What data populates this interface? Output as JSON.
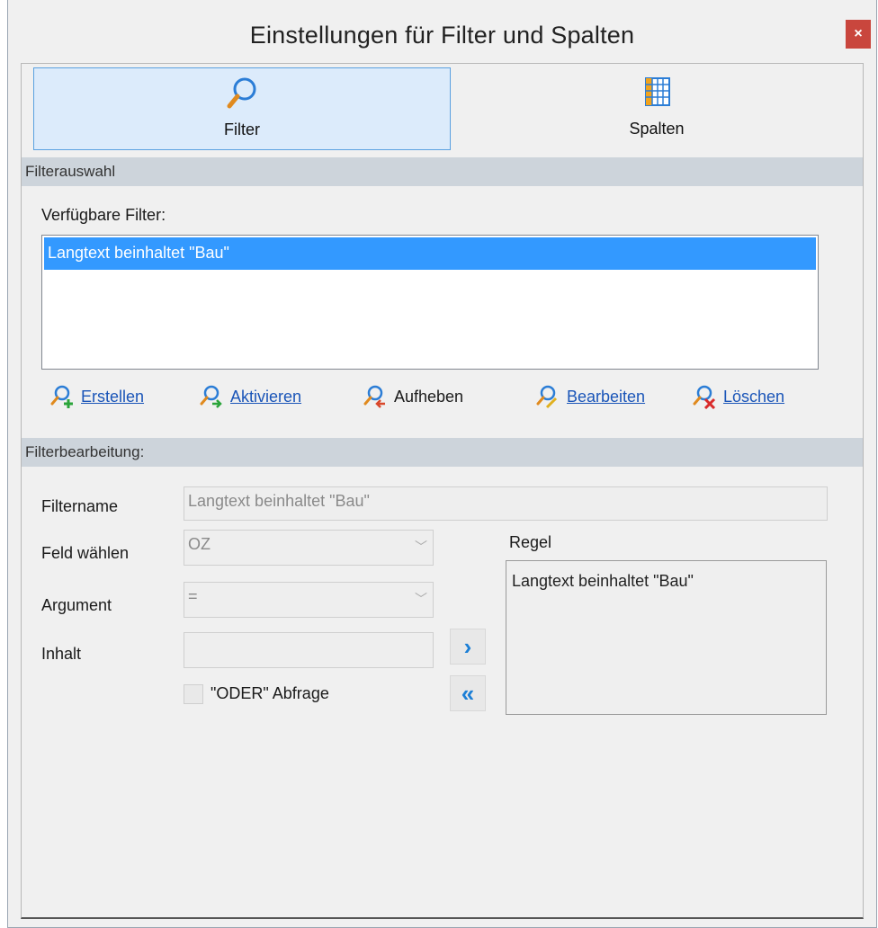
{
  "window": {
    "title": "Einstellungen für Filter und Spalten",
    "close_symbol": "×"
  },
  "toolbar": {
    "filter_label": "Filter",
    "spalten_label": "Spalten",
    "filter_icon": "magnifier-icon",
    "spalten_icon": "columns-grid-icon"
  },
  "filterauswahl": {
    "header": "Filterauswahl",
    "available_label": "Verfügbare Filter:",
    "items": [
      "Langtext beinhaltet \"Bau\""
    ]
  },
  "actions": [
    {
      "label": "Erstellen",
      "link": true,
      "icon": "add-filter-icon"
    },
    {
      "label": "Aktivieren",
      "link": true,
      "icon": "activate-filter-icon"
    },
    {
      "label": "Aufheben",
      "link": false,
      "icon": "remove-filter-icon"
    },
    {
      "label": "Bearbeiten",
      "link": true,
      "icon": "edit-filter-icon"
    },
    {
      "label": "Löschen",
      "link": true,
      "icon": "delete-filter-icon"
    }
  ],
  "filterbearbeitung": {
    "header": "Filterbearbeitung:",
    "filtername_label": "Filtername",
    "filtername_value": "Langtext beinhaltet \"Bau\"",
    "feld_label": "Feld wählen",
    "feld_value": "OZ",
    "argument_label": "Argument",
    "argument_value": "=",
    "inhalt_label": "Inhalt",
    "inhalt_value": "",
    "oder_label": "\"ODER\" Abfrage",
    "add_rule_symbol": "›",
    "clear_rules_symbol": "«",
    "regel_label": "Regel",
    "regel_value": "Langtext beinhaltet \"Bau\""
  },
  "colors": {
    "selection": "#3399ff",
    "link": "#1a55b8",
    "section_header": "#cdd4db",
    "close_button": "#c9463d"
  }
}
